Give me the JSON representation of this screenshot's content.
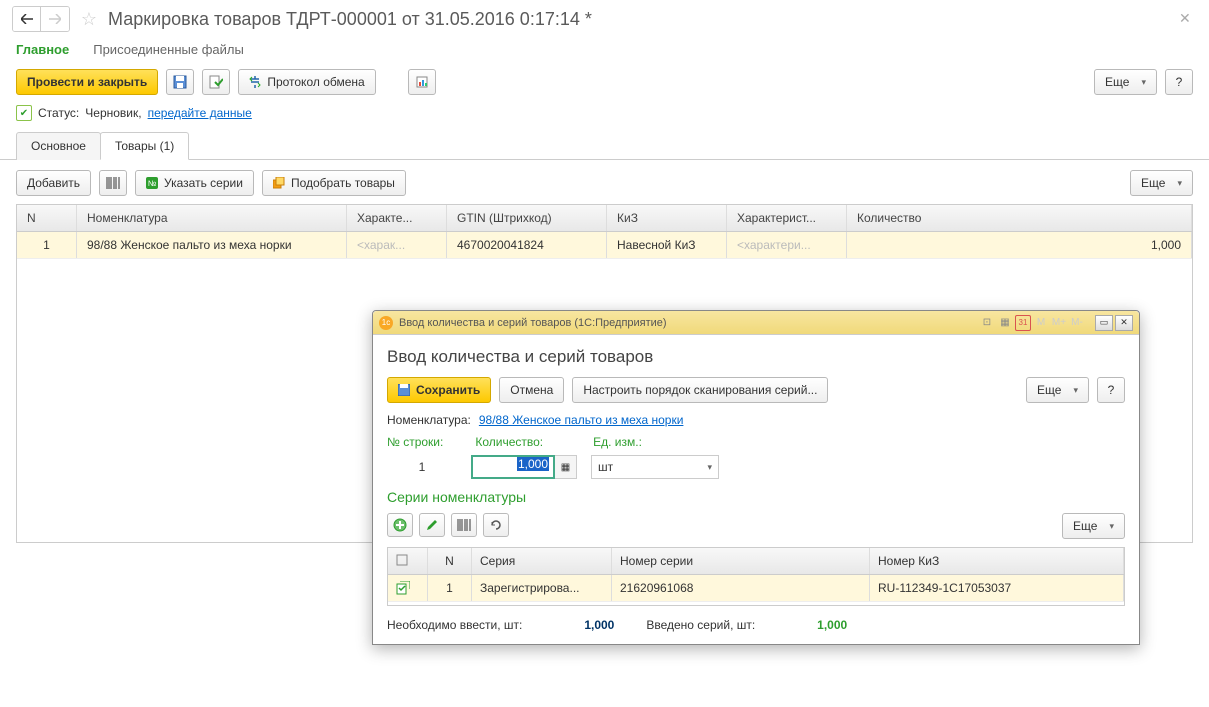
{
  "header": {
    "title": "Маркировка товаров ТДРТ-000001 от 31.05.2016 0:17:14 *"
  },
  "main_tabs": {
    "main": "Главное",
    "files": "Присоединенные файлы"
  },
  "toolbar": {
    "post_close": "Провести и закрыть",
    "protocol": "Протокол обмена",
    "more": "Еще",
    "help": "?"
  },
  "status": {
    "label": "Статус:",
    "value": "Черновик,",
    "link": "передайте данные"
  },
  "sub_tabs": {
    "main": "Основное",
    "goods": "Товары (1)"
  },
  "goods_toolbar": {
    "add": "Добавить",
    "series": "Указать серии",
    "pick": "Подобрать товары",
    "more": "Еще"
  },
  "table": {
    "headers": {
      "n": "N",
      "nom": "Номенклатура",
      "char": "Характе...",
      "gtin": "GTIN (Штрихкод)",
      "kiz": "КиЗ",
      "char2": "Характерист...",
      "qty": "Количество"
    },
    "rows": [
      {
        "n": "1",
        "nom": "98/88 Женское пальто из меха норки",
        "char_ph": "<харак...",
        "gtin": "4670020041824",
        "kiz": "Навесной КиЗ",
        "char2_ph": "<характери...",
        "qty": "1,000"
      }
    ]
  },
  "dialog": {
    "titlebar": "Ввод количества и серий товаров  (1С:Предприятие)",
    "tb_icons": {
      "cal": "31",
      "m": "M",
      "mplus": "M+",
      "mminus": "M-"
    },
    "heading": "Ввод количества и серий товаров",
    "buttons": {
      "save": "Сохранить",
      "cancel": "Отмена",
      "scan_order": "Настроить порядок сканирования серий...",
      "more": "Еще",
      "help": "?"
    },
    "nom_label": "Номенклатура:",
    "nom_link": "98/88 Женское пальто из меха норки",
    "cols": {
      "row_no": "№ строки:",
      "qty": "Количество:",
      "unit": "Ед. изм.:"
    },
    "row_no": "1",
    "qty_value": "1,000",
    "unit": "шт",
    "series_heading": "Серии номенклатуры",
    "series_toolbar": {
      "more": "Еще"
    },
    "series_headers": {
      "n": "N",
      "ser": "Серия",
      "num": "Номер серии",
      "kiz": "Номер КиЗ"
    },
    "series_rows": [
      {
        "n": "1",
        "ser": "Зарегистрирова...",
        "num": "21620961068",
        "kiz": "RU-112349-1С17053037"
      }
    ],
    "footer": {
      "need_label": "Необходимо ввести, шт:",
      "need_value": "1,000",
      "entered_label": "Введено серий, шт:",
      "entered_value": "1,000"
    }
  }
}
